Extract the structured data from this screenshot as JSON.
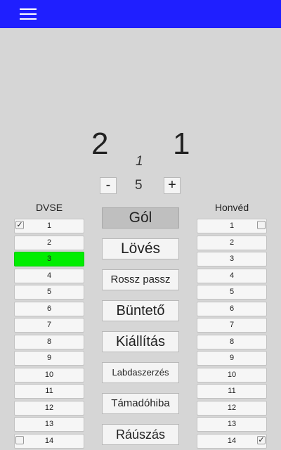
{
  "header": {
    "menu_icon": "hamburger-menu-icon",
    "bar_color": "#1f1fff"
  },
  "score": {
    "home": "2",
    "away": "1",
    "period": "1"
  },
  "stepper": {
    "minus_label": "-",
    "value": "5",
    "plus_label": "+"
  },
  "teams": {
    "home_name": "DVSE",
    "away_name": "Honvéd"
  },
  "home_players": [
    "1",
    "2",
    "3",
    "4",
    "5",
    "6",
    "7",
    "8",
    "9",
    "10",
    "11",
    "12",
    "13",
    "14"
  ],
  "away_players": [
    "1",
    "2",
    "3",
    "4",
    "5",
    "6",
    "7",
    "8",
    "9",
    "10",
    "11",
    "12",
    "13",
    "14"
  ],
  "home_checkboxes": {
    "player_1": true,
    "player_14": false
  },
  "away_checkboxes": {
    "player_1": false,
    "player_14": true
  },
  "home_active_player": "3",
  "active_color": "#00ee00",
  "actions": {
    "goal": "Gól",
    "shot": "Lövés",
    "bad_pass": "Rossz passz",
    "penalty": "Büntető",
    "exclusion": "Kiállítás",
    "steal": "Labdaszerzés",
    "attack_error": "Támadóhiba",
    "swim_off": "Ráúszás"
  },
  "selected_action": "goal"
}
